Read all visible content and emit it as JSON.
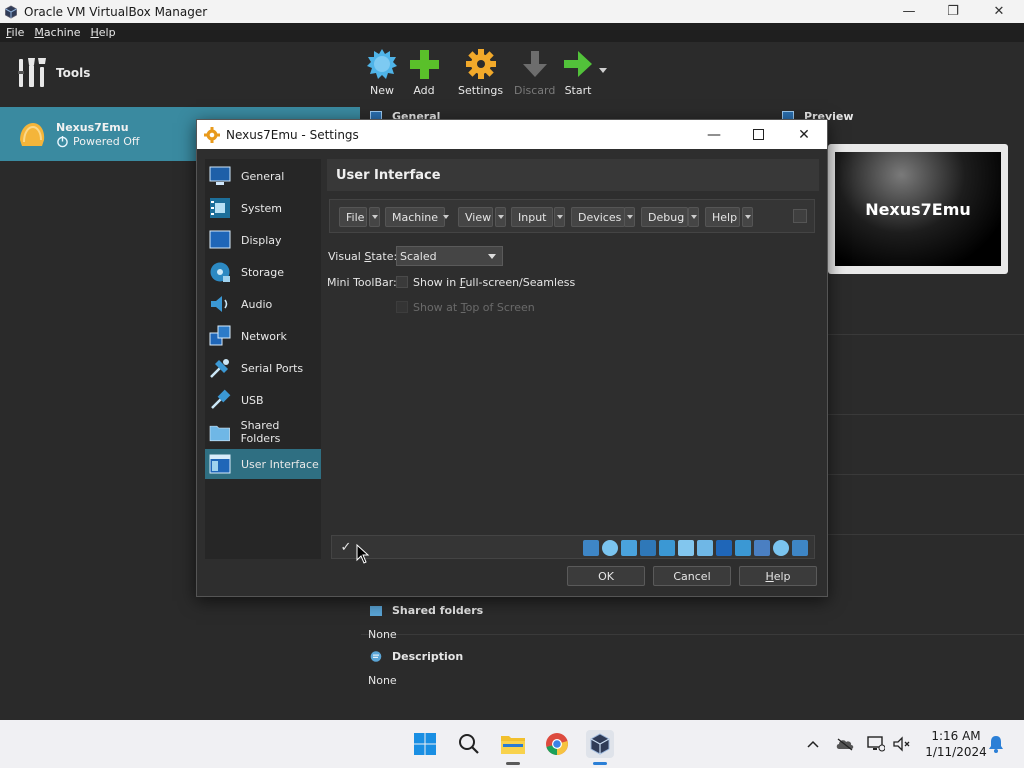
{
  "window": {
    "title": "Oracle VM VirtualBox Manager",
    "controls": [
      "—",
      "❐",
      "✕"
    ]
  },
  "menubar": {
    "items": [
      {
        "label": "File",
        "mnemonic": "F",
        "rest": "ile"
      },
      {
        "label": "Machine",
        "mnemonic": "M",
        "rest": "achine"
      },
      {
        "label": "Help",
        "mnemonic": "H",
        "rest": "elp"
      }
    ]
  },
  "left": {
    "tools_label": "Tools",
    "vm": {
      "name": "Nexus7Emu",
      "state": "Powered Off"
    }
  },
  "toolbar": {
    "new": "New",
    "add": "Add",
    "settings": "Settings",
    "discard": "Discard",
    "start": "Start"
  },
  "details": {
    "general": "General",
    "preview": "Preview",
    "preview_vm_name": "Nexus7Emu",
    "shared_folders": {
      "title": "Shared folders",
      "value": "None"
    },
    "description": {
      "title": "Description",
      "value": "None"
    }
  },
  "dialog": {
    "title": "Nexus7Emu - Settings",
    "nav": [
      {
        "label": "General",
        "icon": "general-icon"
      },
      {
        "label": "System",
        "icon": "system-icon"
      },
      {
        "label": "Display",
        "icon": "display-icon"
      },
      {
        "label": "Storage",
        "icon": "storage-icon"
      },
      {
        "label": "Audio",
        "icon": "audio-icon"
      },
      {
        "label": "Network",
        "icon": "network-icon"
      },
      {
        "label": "Serial Ports",
        "icon": "serial-ports-icon"
      },
      {
        "label": "USB",
        "icon": "usb-icon"
      },
      {
        "label": "Shared Folders",
        "icon": "shared-folders-icon"
      },
      {
        "label": "User Interface",
        "icon": "user-interface-icon",
        "selected": true
      }
    ],
    "page_title": "User Interface",
    "menu_editor": [
      "File",
      "Machine",
      "View",
      "Input",
      "Devices",
      "Debug",
      "Help"
    ],
    "visual_state": {
      "label_pre": "Visual ",
      "label_mn": "S",
      "label_post": "tate:",
      "value": "Scaled"
    },
    "mini_toolbar": {
      "label": "Mini ToolBar:"
    },
    "show_fullscreen": {
      "pre": "Show in ",
      "mn": "F",
      "post": "ull-screen/Seamless"
    },
    "show_top": {
      "pre": "Show at ",
      "mn": "T",
      "post": "op of Screen"
    },
    "statusbar_check": "✓",
    "buttons": {
      "ok": "OK",
      "cancel": "Cancel",
      "help_mn": "H",
      "help_rest": "elp"
    }
  },
  "taskbar": {
    "time": "1:16 AM",
    "date": "1/11/2024"
  },
  "colors": {
    "selection": "#3a8aa0",
    "dialog_selection": "#2f6f82",
    "new_icon": "#4fb4e8",
    "add_icon": "#5ac02a",
    "settings_icon": "#f2a92a",
    "start_icon": "#52c23a"
  }
}
